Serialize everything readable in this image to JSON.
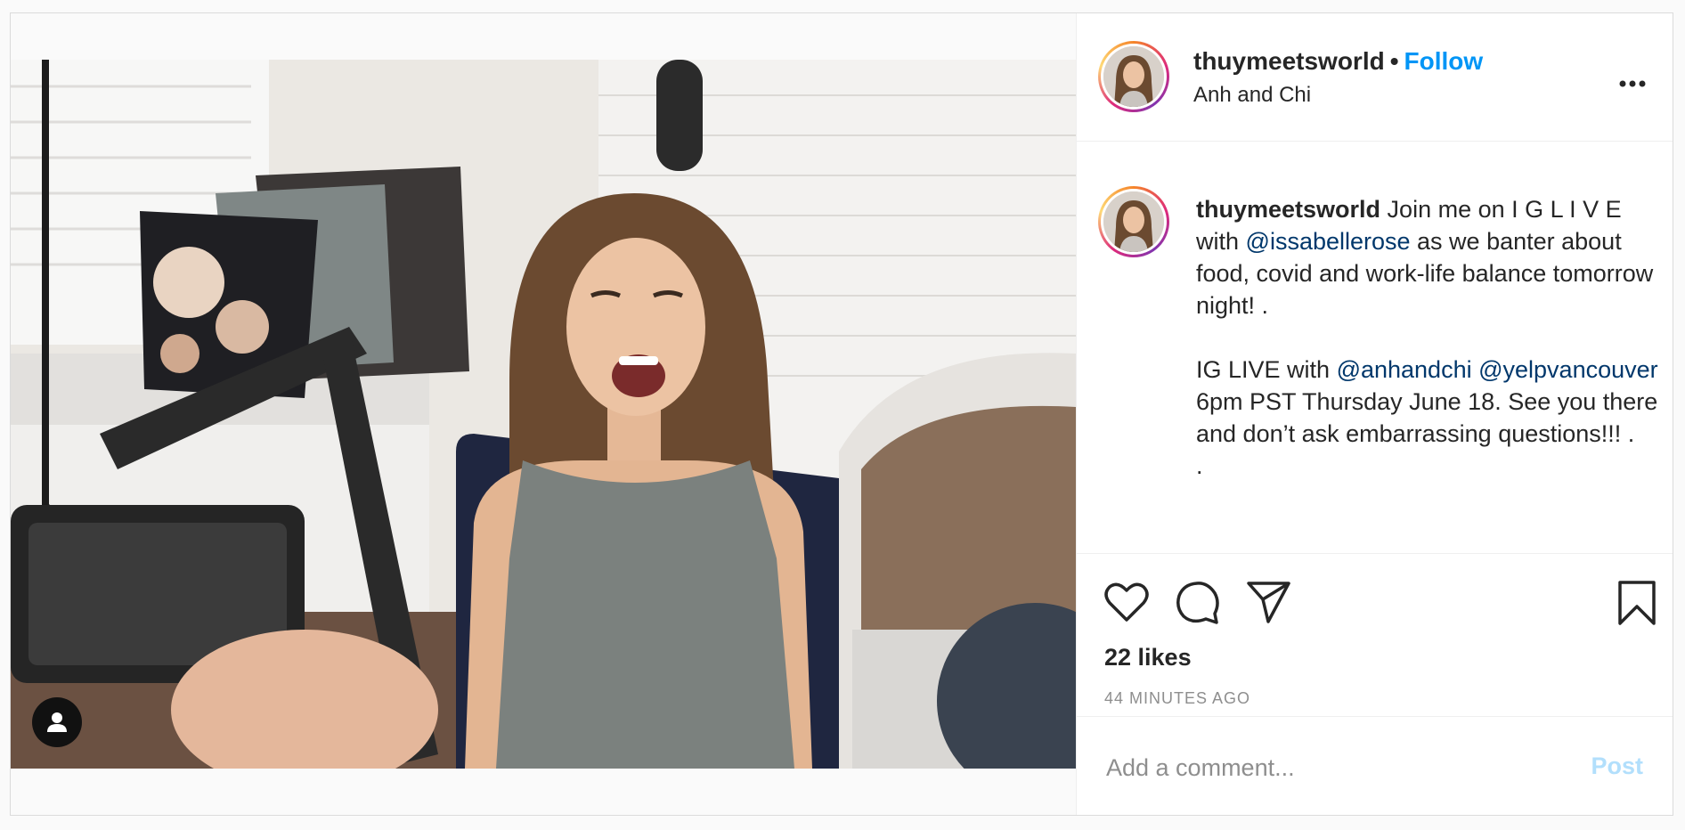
{
  "post": {
    "username": "thuymeetsworld",
    "separator": "•",
    "follow_label": "Follow",
    "location": "Anh and Chi",
    "more_icon": "more-options-icon"
  },
  "caption": {
    "username": "thuymeetsworld",
    "part1": " Join me on I G L I V E with ",
    "mention1": "@issabellerose",
    "part2": " as we banter about food, covid and work-life balance tomorrow night! .\n\nIG LIVE with ",
    "mention2": "@anhandchi",
    "part3": " ",
    "mention3": "@yelpvancouver",
    "part4": " 6pm PST Thursday June 18. See you there and don’t ask embarrassing questions!!! .\n."
  },
  "actions": {
    "like_icon": "heart-icon",
    "comment_icon": "comment-icon",
    "share_icon": "share-icon",
    "save_icon": "bookmark-icon"
  },
  "likes": "22 likes",
  "timestamp": "44 MINUTES AGO",
  "comment": {
    "placeholder": "Add a comment...",
    "post_label": "Post"
  },
  "colors": {
    "accent": "#0095f6",
    "mention": "#00376b",
    "post_disabled": "#b2dffc",
    "muted": "#8e8e8e"
  }
}
